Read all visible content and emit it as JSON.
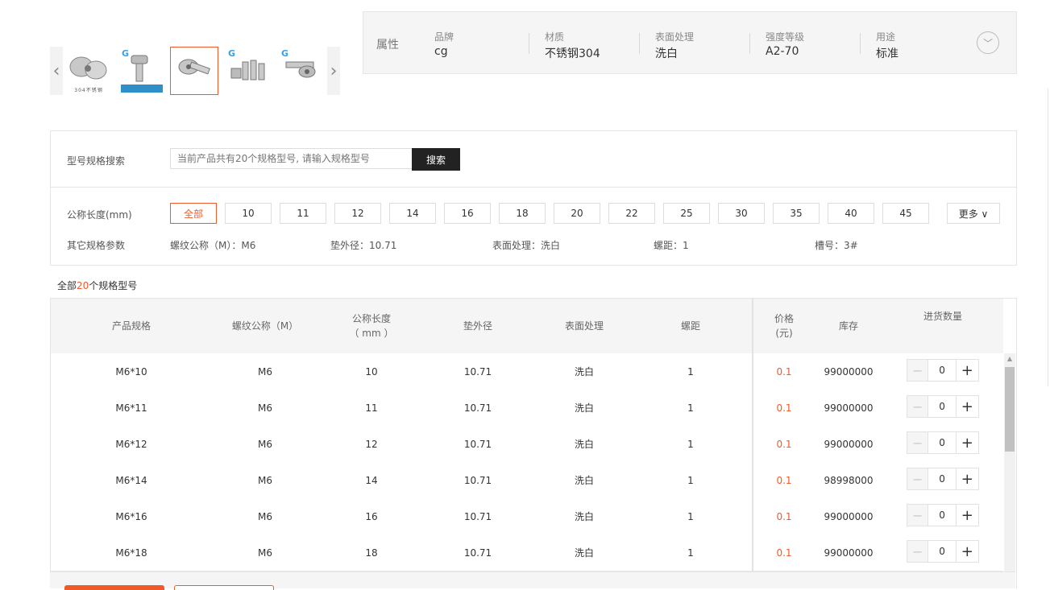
{
  "gallery": {
    "prev_icon": "‹",
    "next_icon": "›",
    "thumbs": [
      {
        "logo": "",
        "caption": "304不锈钢"
      },
      {
        "logo": "G",
        "caption": ""
      },
      {
        "logo": "",
        "caption": ""
      },
      {
        "logo": "G",
        "caption": ""
      },
      {
        "logo": "G",
        "caption": ""
      }
    ],
    "selected_index": 2
  },
  "attributes": {
    "title": "属性",
    "items": [
      {
        "key": "品牌",
        "value": "cg"
      },
      {
        "key": "材质",
        "value": "不锈钢304"
      },
      {
        "key": "表面处理",
        "value": "洗白"
      },
      {
        "key": "强度等级",
        "value": "A2-70"
      },
      {
        "key": "用途",
        "value": "标准"
      }
    ],
    "expand_icon": "﹀"
  },
  "search": {
    "label": "型号规格搜索",
    "placeholder": "当前产品共有20个规格型号, 请输入规格型号",
    "button": "搜索"
  },
  "length_filter": {
    "label": "公称长度(mm)",
    "options": [
      "全部",
      "10",
      "11",
      "12",
      "14",
      "16",
      "18",
      "20",
      "22",
      "25",
      "30",
      "35",
      "40",
      "45"
    ],
    "active": "全部",
    "more": "更多 ∨"
  },
  "other_specs": {
    "label": "其它规格参数",
    "items": [
      "螺纹公称（M）：M6",
      "垫外径：10.71",
      "表面处理：洗白",
      "螺距：1",
      "槽号：3#"
    ]
  },
  "results": {
    "prefix": "全部",
    "count": "20",
    "suffix": "个规格型号"
  },
  "table": {
    "headers": {
      "spec": "产品规格",
      "thread": "螺纹公称（M）",
      "length_line1": "公称长度",
      "length_line2": "（ mm ）",
      "washer": "垫外径",
      "surface": "表面处理",
      "pitch": "螺距",
      "price_line1": "价格",
      "price_line2": "(元)",
      "stock": "库存",
      "qty": "进货数量"
    },
    "rows": [
      {
        "spec": "M6*10",
        "thread": "M6",
        "length": "10",
        "washer": "10.71",
        "surface": "洗白",
        "pitch": "1",
        "price": "0.1",
        "stock": "99000000",
        "qty": "0"
      },
      {
        "spec": "M6*11",
        "thread": "M6",
        "length": "11",
        "washer": "10.71",
        "surface": "洗白",
        "pitch": "1",
        "price": "0.1",
        "stock": "99000000",
        "qty": "0"
      },
      {
        "spec": "M6*12",
        "thread": "M6",
        "length": "12",
        "washer": "10.71",
        "surface": "洗白",
        "pitch": "1",
        "price": "0.1",
        "stock": "99000000",
        "qty": "0"
      },
      {
        "spec": "M6*14",
        "thread": "M6",
        "length": "14",
        "washer": "10.71",
        "surface": "洗白",
        "pitch": "1",
        "price": "0.1",
        "stock": "98998000",
        "qty": "0"
      },
      {
        "spec": "M6*16",
        "thread": "M6",
        "length": "16",
        "washer": "10.71",
        "surface": "洗白",
        "pitch": "1",
        "price": "0.1",
        "stock": "99000000",
        "qty": "0"
      },
      {
        "spec": "M6*18",
        "thread": "M6",
        "length": "18",
        "washer": "10.71",
        "surface": "洗白",
        "pitch": "1",
        "price": "0.1",
        "stock": "99000000",
        "qty": "0"
      }
    ],
    "minus_icon": "−",
    "plus_icon": "+"
  },
  "colors": {
    "accent": "#f05a28",
    "dark_button": "#222222"
  }
}
